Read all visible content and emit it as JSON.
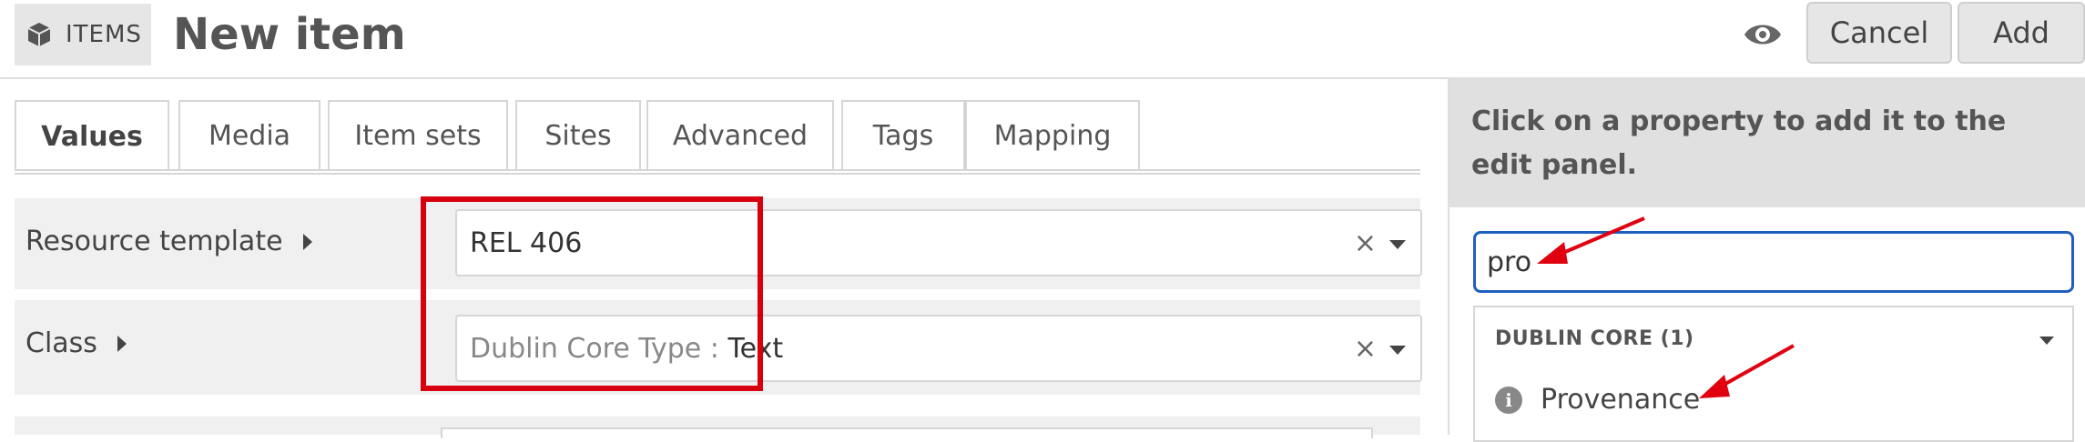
{
  "header": {
    "breadcrumb_label": "ITEMS",
    "page_title": "New item",
    "cancel_label": "Cancel",
    "add_label": "Add"
  },
  "tabs": [
    {
      "label": "Values",
      "active": true
    },
    {
      "label": "Media"
    },
    {
      "label": "Item sets"
    },
    {
      "label": "Sites"
    },
    {
      "label": "Advanced"
    },
    {
      "label": "Tags"
    },
    {
      "label": "Mapping"
    }
  ],
  "fields": {
    "resource_template": {
      "label": "Resource template",
      "value": "REL 406",
      "clear": "×"
    },
    "class": {
      "label": "Class",
      "vocab": "Dublin Core Type",
      "separator": " : ",
      "value": "Text",
      "clear": "×"
    }
  },
  "sidebar": {
    "instructions": "Click on a property to add it to the edit panel.",
    "search_value": "pro",
    "group_title": "DUBLIN CORE (1)",
    "property": "Provenance",
    "info_glyph": "i"
  },
  "colors": {
    "highlight_box": "#d7000f",
    "annotation_arrow": "#e00010",
    "search_border": "#1f5fbf"
  }
}
